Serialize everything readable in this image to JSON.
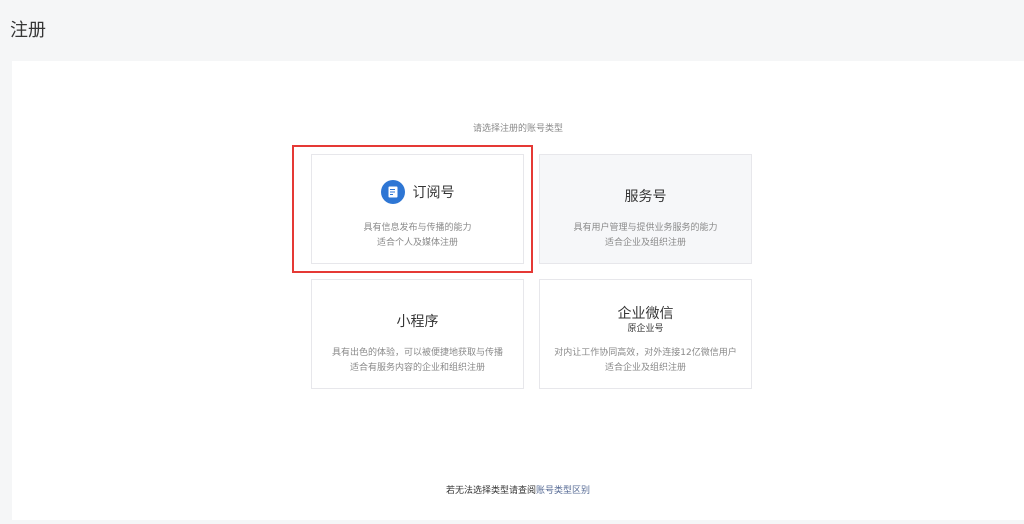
{
  "page": {
    "title": "注册"
  },
  "prompt": "请选择注册的账号类型",
  "cards": {
    "subscription": {
      "title": "订阅号",
      "icon": "document-icon",
      "desc_line1": "具有信息发布与传播的能力",
      "desc_line2": "适合个人及媒体注册"
    },
    "service": {
      "title": "服务号",
      "desc_line1": "具有用户管理与提供业务服务的能力",
      "desc_line2": "适合企业及组织注册"
    },
    "miniprogram": {
      "title": "小程序",
      "desc_line1": "具有出色的体验，可以被便捷地获取与传播",
      "desc_line2": "适合有服务内容的企业和组织注册"
    },
    "wework": {
      "title": "企业微信",
      "subtitle": "原企业号",
      "desc_line1": "对内让工作协同高效，对外连接12亿微信用户",
      "desc_line2": "适合企业及组织注册"
    }
  },
  "footer": {
    "text": "若无法选择类型请查阅",
    "link": "账号类型区别"
  },
  "colors": {
    "accent": "#2e76d4",
    "highlight": "#e53935",
    "link": "#576b95"
  }
}
